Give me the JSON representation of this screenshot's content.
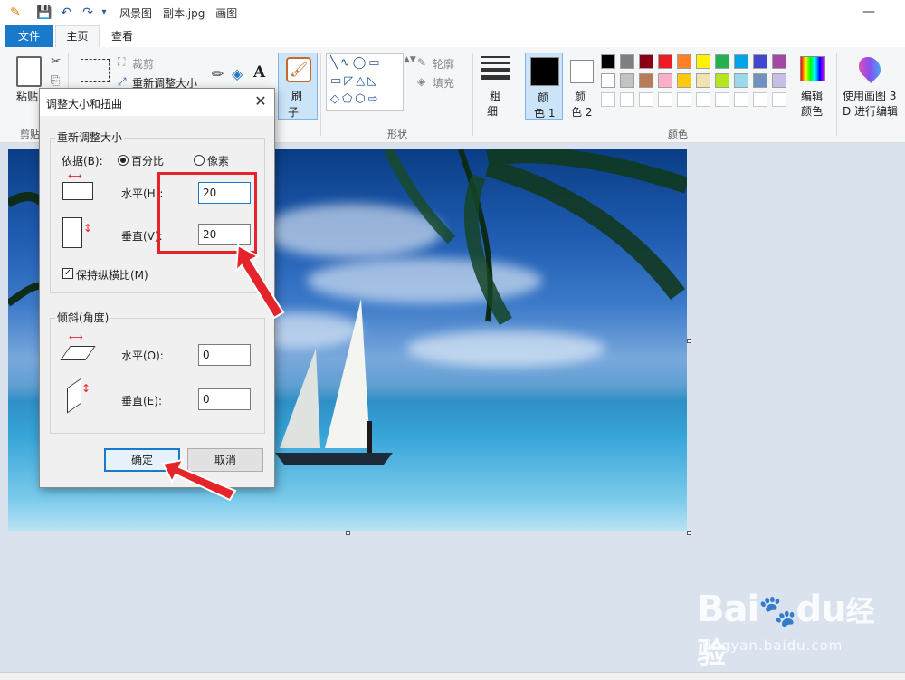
{
  "app": {
    "title": "风景图 - 副本.jpg - 画图",
    "minimize_glyph": "—"
  },
  "tabs": {
    "file": "文件",
    "home": "主页",
    "view": "查看"
  },
  "ribbon": {
    "clipboard": {
      "paste": "粘贴",
      "group_label": "剪贴"
    },
    "image": {
      "crop": "裁剪",
      "resize": "重新调整大小"
    },
    "brush": {
      "label_line1": "刷",
      "label_line2": "子"
    },
    "shapes": {
      "outline": "轮廓",
      "fill": "填充",
      "group_label": "形状"
    },
    "size": {
      "label_line1": "粗",
      "label_line2": "细"
    },
    "color1": {
      "line1": "颜",
      "line2": "色 1"
    },
    "color2": {
      "line1": "颜",
      "line2": "色 2"
    },
    "edit_colors": {
      "line1": "编辑",
      "line2": "颜色"
    },
    "colors_group_label": "颜色",
    "paint3d": {
      "line1": "使用画图 3",
      "line2": "D 进行编辑"
    },
    "palette_row1": [
      "#000000",
      "#7f7f7f",
      "#880015",
      "#ed1c24",
      "#ff7f27",
      "#fff200",
      "#22b14c",
      "#00a2e8",
      "#3f48cc",
      "#a349a4"
    ],
    "palette_row2": [
      "#ffffff",
      "#c3c3c3",
      "#b97a57",
      "#ffaec9",
      "#ffc90e",
      "#efe4b0",
      "#b5e61d",
      "#99d9ea",
      "#7092be",
      "#c8bfe7"
    ]
  },
  "dialog": {
    "title": "调整大小和扭曲",
    "close_glyph": "✕",
    "resize_section": "重新调整大小",
    "by_label": "依据(B):",
    "option_percent": "百分比",
    "option_pixels": "像素",
    "horizontal_label": "水平(H):",
    "horizontal_value": "20",
    "vertical_label": "垂直(V):",
    "vertical_value": "20",
    "keep_ratio_label": "保持纵横比(M)",
    "keep_ratio_checked": "✓",
    "skew_section": "倾斜(角度)",
    "skew_horizontal_label": "水平(O):",
    "skew_horizontal_value": "0",
    "skew_vertical_label": "垂直(E):",
    "skew_vertical_value": "0",
    "ok": "确定",
    "cancel": "取消"
  },
  "watermark": {
    "brand": "Bai",
    "brand2": "du",
    "brand_cn": "经验",
    "url": "jingyan.baidu.com"
  },
  "colors": {
    "accent": "#1979ca",
    "annotation": "#e4232a"
  }
}
